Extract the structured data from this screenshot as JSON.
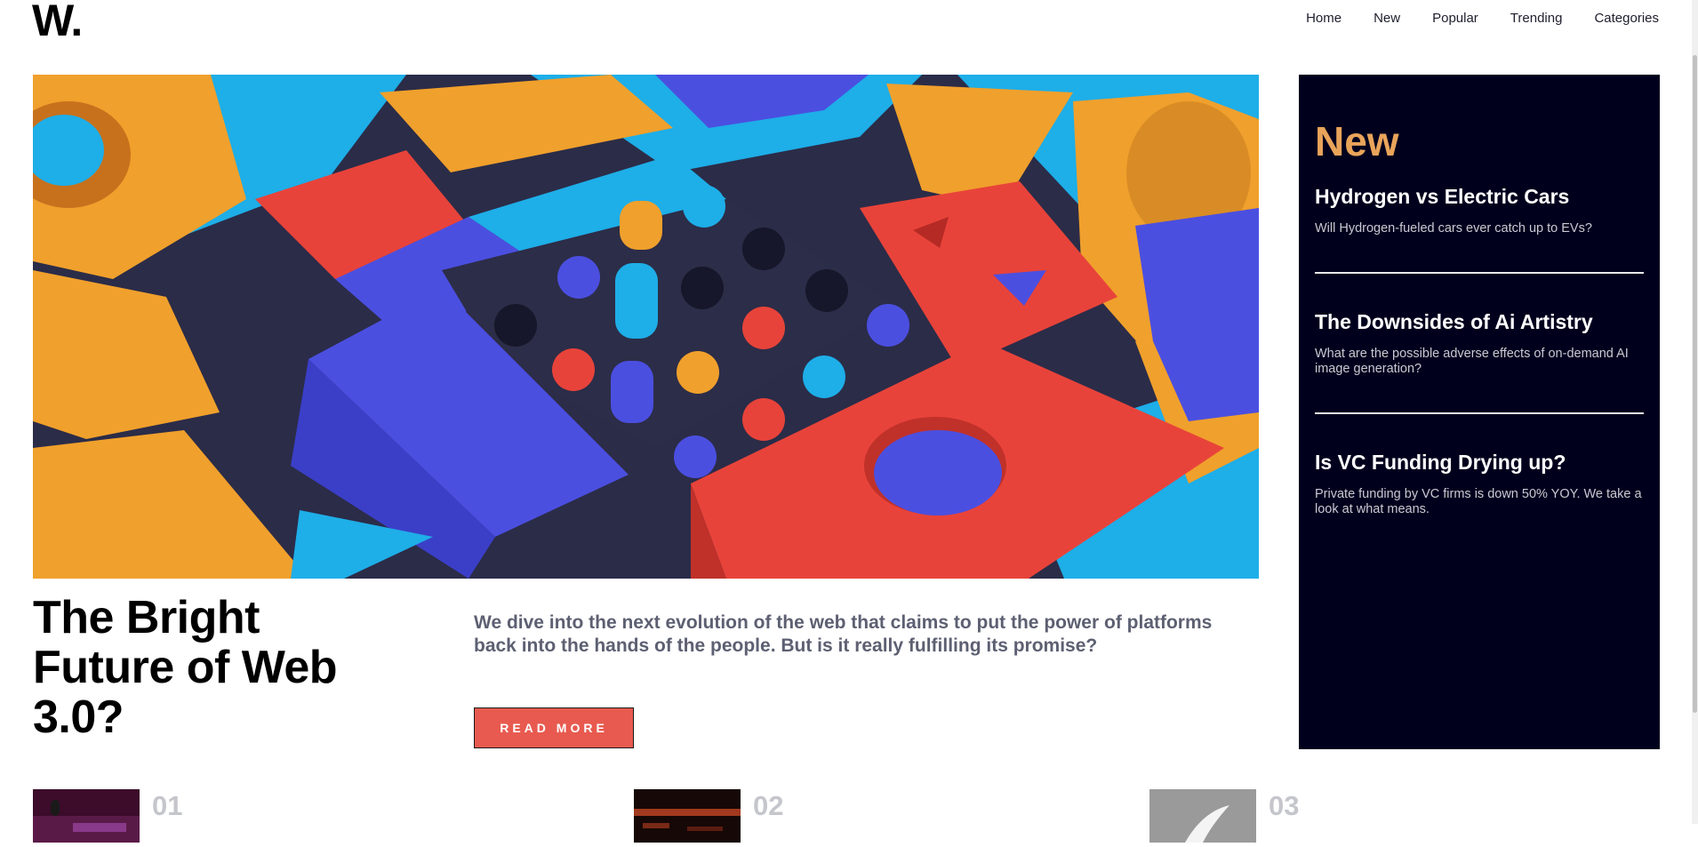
{
  "logo": "W.",
  "nav": [
    "Home",
    "New",
    "Popular",
    "Trending",
    "Categories"
  ],
  "hero": {
    "title": "The Bright Future of Web 3.0?",
    "description": "We dive into the next evolution of the web that claims to put the power of platforms back into the hands of the people. But is it really fulfilling its promise?",
    "button_label": "READ MORE"
  },
  "sidebar": {
    "heading": "New",
    "items": [
      {
        "title": "Hydrogen vs Electric Cars",
        "summary": "Will Hydrogen-fueled cars ever catch up to EVs?"
      },
      {
        "title": "The Downsides of Ai Artistry",
        "summary": "What are the possible adverse effects of on-demand AI image generation?"
      },
      {
        "title": "Is VC Funding Drying up?",
        "summary": "Private funding by VC firms is down 50% YOY. We take a look at what means."
      }
    ]
  },
  "cards": [
    {
      "number": "01"
    },
    {
      "number": "02"
    },
    {
      "number": "03"
    }
  ],
  "colors": {
    "accent": "#e85a4f",
    "sidebar_bg": "#00001d",
    "sidebar_heading": "#e9a45a",
    "muted_text": "#5d6072"
  }
}
